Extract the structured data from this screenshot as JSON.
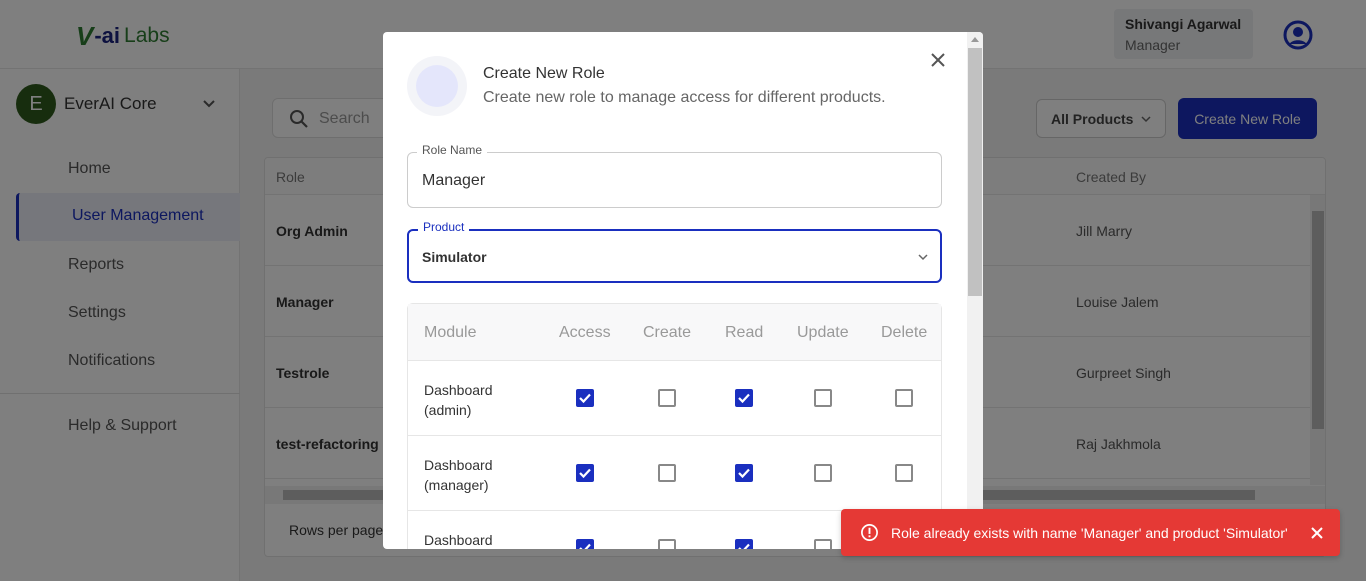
{
  "brand": {
    "logo_v": "V",
    "logo_ai": "-ai",
    "logo_labs": "Labs"
  },
  "user": {
    "name": "Shivangi Agarwal",
    "role": "Manager"
  },
  "org": {
    "initial": "E",
    "name": "EverAI Core"
  },
  "sidebar": {
    "items": [
      {
        "label": "Home"
      },
      {
        "label": "User Management"
      },
      {
        "label": "Reports"
      },
      {
        "label": "Settings"
      },
      {
        "label": "Notifications"
      },
      {
        "label": "Help & Support"
      }
    ]
  },
  "toolbar": {
    "search_placeholder": "Search",
    "filter_label": "All Products",
    "create_label": "Create New Role"
  },
  "roles_table": {
    "col_role": "Role",
    "col_created_by": "Created By",
    "rows": [
      {
        "role": "Org Admin",
        "created_by": "Jill Marry"
      },
      {
        "role": "Manager",
        "created_by": "Louise Jalem"
      },
      {
        "role": "Testrole",
        "created_by": "Gurpreet Singh"
      },
      {
        "role": "test-refactoring",
        "created_by": "Raj Jakhmola"
      }
    ],
    "rows_per_page_label": "Rows per page"
  },
  "modal": {
    "title": "Create New Role",
    "subtitle": "Create new role to manage access for different products.",
    "role_name_label": "Role Name",
    "role_name_value": "Manager",
    "product_label": "Product",
    "product_value": "Simulator",
    "perm_headers": [
      "Module",
      "Access",
      "Create",
      "Read",
      "Update",
      "Delete"
    ],
    "perm_rows": [
      {
        "module": "Dashboard (admin)",
        "access": true,
        "create": false,
        "read": true,
        "update": false,
        "delete": false
      },
      {
        "module": "Dashboard (manager)",
        "access": true,
        "create": false,
        "read": true,
        "update": false,
        "delete": false
      },
      {
        "module": "Dashboard",
        "access": true,
        "create": false,
        "read": true,
        "update": false,
        "delete": false
      }
    ]
  },
  "toast": {
    "message": "Role already exists with name 'Manager' and product 'Simulator'",
    "color": "#e53935"
  },
  "colors": {
    "primary": "#1a2fbf",
    "brand_green": "#2e7d32",
    "org_badge": "#2e5a1c"
  }
}
